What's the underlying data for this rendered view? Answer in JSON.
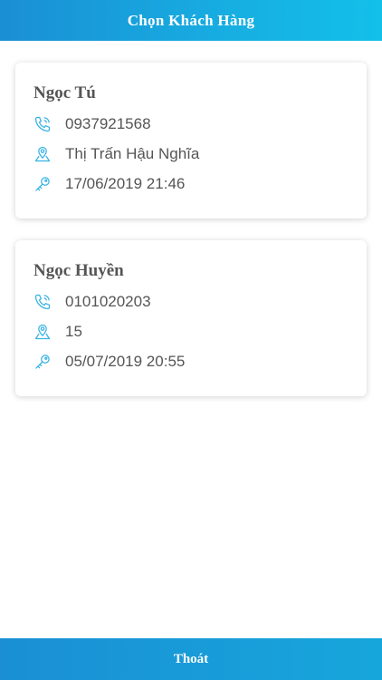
{
  "header": {
    "title": "Chọn Khách Hàng"
  },
  "customers": [
    {
      "name": "Ngọc Tú",
      "phone": "0937921568",
      "address": "Thị Trấn Hậu Nghĩa",
      "datetime": "17/06/2019 21:46"
    },
    {
      "name": "Ngọc Huyền",
      "phone": "0101020203",
      "address": "15",
      "datetime": "05/07/2019 20:55"
    }
  ],
  "icons": {
    "phone": "phone-icon",
    "location": "location-pin-icon",
    "key": "key-icon"
  },
  "colors": {
    "accent": "#1a9bd8",
    "icon": "#36b3e3",
    "text": "#555555"
  },
  "footer": {
    "exit_label": "Thoát"
  }
}
